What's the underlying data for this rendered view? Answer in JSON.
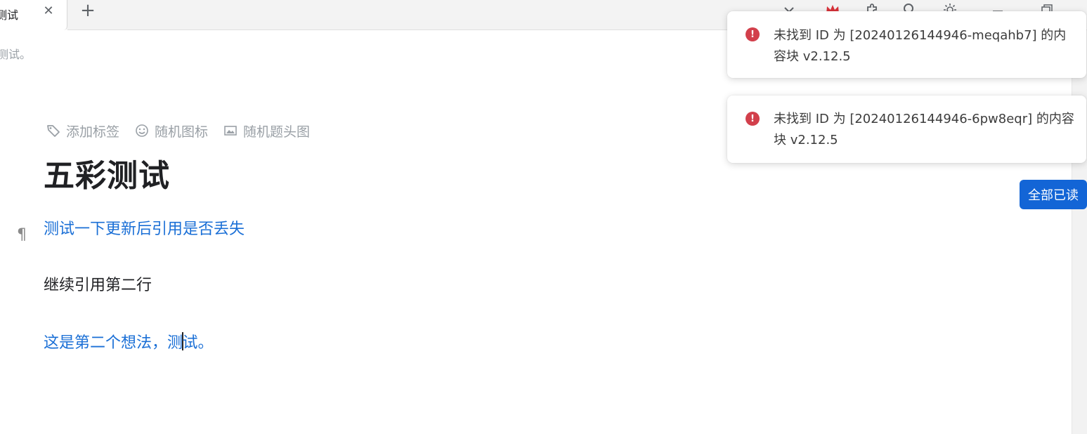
{
  "tab": {
    "title": "测试",
    "close_glyph": "✕",
    "add_glyph": "+"
  },
  "toolbar_icons": [
    "chevron-down-icon",
    "crown-icon",
    "puzzle-icon",
    "search-icon",
    "sun-icon",
    "minimize-icon",
    "restore-icon"
  ],
  "breadcrumb": "测试。",
  "doc": {
    "meta": {
      "add_tag": "添加标签",
      "random_icon": "随机图标",
      "random_cover": "随机题头图"
    },
    "title": "五彩测试",
    "paragraph_mark": "¶",
    "blocks": {
      "ref_line": "测试一下更新后引用是否丢失",
      "continue_line": "继续引用第二行",
      "idea_before_caret": "这是第二个想法，测",
      "idea_after_caret": "试。"
    }
  },
  "notifications": [
    {
      "icon": "error-icon",
      "line1": "未找到 ID 为 [20240126144946-meqahb7] 的内",
      "line2": "容块 v2.12.5"
    },
    {
      "icon": "error-icon",
      "line1": "未找到 ID 为 [20240126144946-6pw8eqr] 的内容",
      "line2": "块 v2.12.5"
    }
  ],
  "mark_all_read": "全部已读",
  "colors": {
    "link": "#1a6fd6",
    "error": "#d23f4b",
    "primary_button": "#1365d6",
    "crown": "#d9323a"
  }
}
